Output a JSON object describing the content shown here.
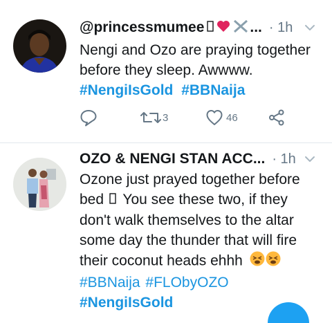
{
  "tweets": [
    {
      "display_name": "@princessmumee",
      "name_suffix": "...",
      "time": "· 1h",
      "text_lines": [
        "Nengi and Ozo are praying together",
        "before they sleep. Awwww."
      ],
      "hashtags": [
        "#NengiIsGold",
        "#BBNaija"
      ],
      "retweets": "3",
      "likes": "46"
    },
    {
      "display_name": "OZO & NENGI STAN ACC...",
      "time": "· 1h",
      "text_lines": [
        "Ozone just prayed together before",
        "bed",
        "You see these two, if they",
        "don't walk themselves to the altar",
        "some day the thunder that will fire",
        "their coconut heads ehhh"
      ],
      "hashtags_line1": [
        "#BBNaija",
        "#FLObyOZO"
      ],
      "hashtags_line2": [
        "#NengiIsGold"
      ]
    }
  ],
  "icons": {
    "reply": "reply-icon",
    "retweet": "retweet-icon",
    "like": "heart-icon",
    "share": "share-icon",
    "caret": "chevron-down-icon"
  },
  "colors": {
    "link": "#1b95e0",
    "muted": "#657786",
    "text": "#14171a",
    "divider": "#e1e8ed"
  }
}
